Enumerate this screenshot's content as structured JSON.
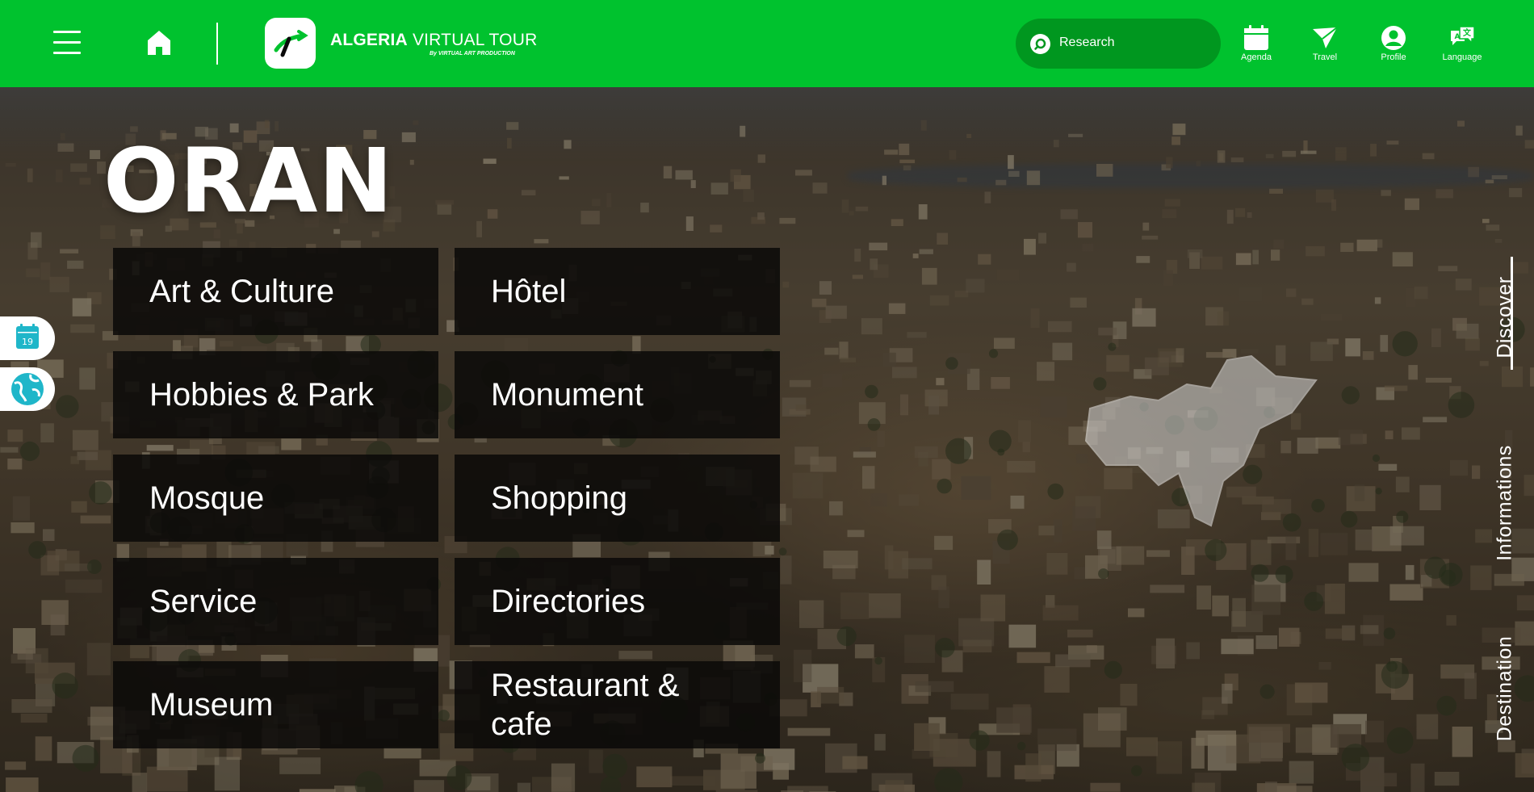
{
  "header": {
    "brand_bold": "ALGERIA",
    "brand_rest": " VIRTUAL TOUR",
    "brand_sub": "By VIRTUAL ART PRODUCTION",
    "search_placeholder": "Research",
    "nav": [
      {
        "label": "Agenda",
        "icon": "calendar-icon"
      },
      {
        "label": "Travel",
        "icon": "paper-plane-icon"
      },
      {
        "label": "Profile",
        "icon": "user-icon"
      },
      {
        "label": "Language",
        "icon": "language-icon"
      }
    ]
  },
  "city": {
    "title": "ORAN"
  },
  "categories": [
    "Art & Culture",
    "Hôtel",
    "Hobbies & Park",
    "Monument",
    "Mosque",
    "Shopping",
    "Service",
    "Directories",
    "Museum",
    "Restaurant & cafe"
  ],
  "side_buttons": {
    "calendar_day": "19"
  },
  "right_tabs": [
    "Discover",
    "Informations",
    "Destination"
  ],
  "active_tab": "Discover",
  "colors": {
    "brand_green": "#00c22e",
    "search_green": "#00971f",
    "accent_teal": "#1fb6c9"
  }
}
